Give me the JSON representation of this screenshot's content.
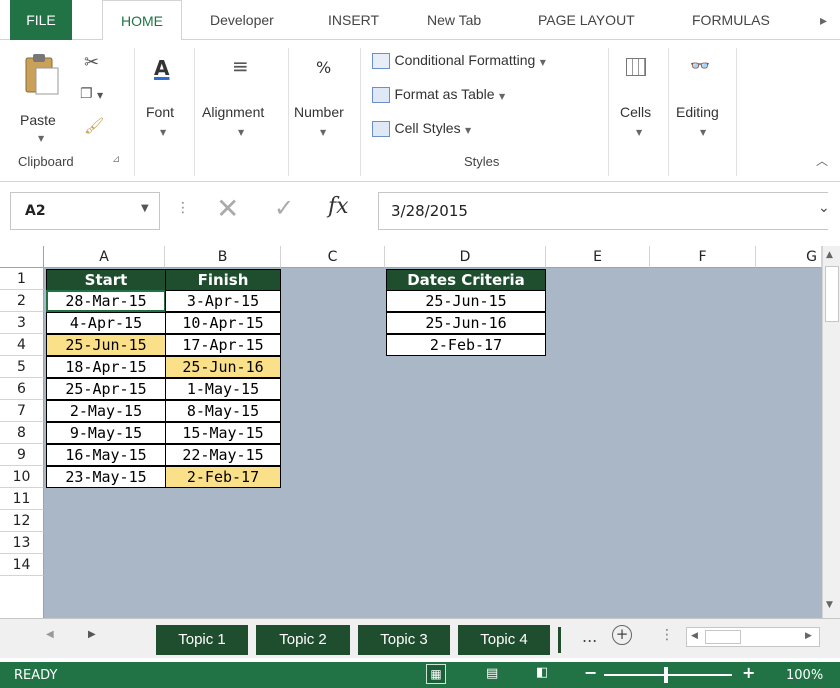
{
  "ribbon_tabs": [
    "FILE",
    "HOME",
    "Developer",
    "INSERT",
    "New Tab",
    "PAGE LAYOUT",
    "FORMULAS"
  ],
  "active_tab": "HOME",
  "clipboard": {
    "paste_label": "Paste",
    "group_label": "Clipboard"
  },
  "font": {
    "label": "Font"
  },
  "alignment": {
    "label": "Alignment"
  },
  "number": {
    "label": "Number",
    "icon_text": "%"
  },
  "styles": {
    "conditional_formatting": "Conditional Formatting",
    "format_as_table": "Format as Table",
    "cell_styles": "Cell Styles",
    "group_label": "Styles"
  },
  "cells": {
    "label": "Cells"
  },
  "editing": {
    "label": "Editing"
  },
  "formula_bar": {
    "name_box": "A2",
    "formula": "3/28/2015",
    "fx": "fx"
  },
  "columns": [
    "A",
    "B",
    "C",
    "D",
    "E",
    "F",
    "G"
  ],
  "rows": [
    "1",
    "2",
    "3",
    "4",
    "5",
    "6",
    "7",
    "8",
    "9",
    "10",
    "11",
    "12",
    "13",
    "14"
  ],
  "table": {
    "headers": [
      "Start",
      "Finish"
    ],
    "start": [
      "28-Mar-15",
      "4-Apr-15",
      "25-Jun-15",
      "18-Apr-15",
      "25-Apr-15",
      "2-May-15",
      "9-May-15",
      "16-May-15",
      "23-May-15"
    ],
    "finish": [
      "3-Apr-15",
      "10-Apr-15",
      "17-Apr-15",
      "25-Jun-16",
      "1-May-15",
      "8-May-15",
      "15-May-15",
      "22-May-15",
      "2-Feb-17"
    ]
  },
  "criteria": {
    "header": "Dates Criteria",
    "values": [
      "25-Jun-15",
      "25-Jun-16",
      "2-Feb-17"
    ]
  },
  "sheet_tabs": [
    "Topic 1",
    "Topic 2",
    "Topic 3",
    "Topic 4"
  ],
  "sheet_more": "...",
  "status": {
    "ready": "READY",
    "zoom": "100%"
  },
  "colors": {
    "excel_green": "#217346",
    "header_fill": "#1f4e2f",
    "highlight": "#fbe08a",
    "grid_bg": "#aab7c6"
  }
}
